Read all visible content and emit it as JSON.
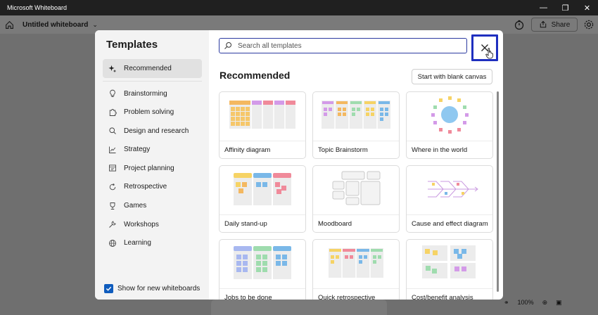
{
  "window": {
    "title": "Microsoft Whiteboard",
    "controls": [
      "minimize-icon",
      "restore-icon",
      "close-icon"
    ]
  },
  "appbar": {
    "board_title": "Untitled whiteboard",
    "share_label": "Share"
  },
  "zoom": {
    "value": "100%"
  },
  "modal": {
    "title": "Templates",
    "search_placeholder": "Search all templates",
    "section_title": "Recommended",
    "blank_button": "Start with blank canvas",
    "show_new_label": "Show for new whiteboards",
    "show_new_checked": true,
    "categories": [
      {
        "label": "Recommended",
        "icon": "sparkle-icon",
        "selected": true
      },
      {
        "label": "Brainstorming",
        "icon": "lightbulb-icon"
      },
      {
        "label": "Problem solving",
        "icon": "puzzle-icon"
      },
      {
        "label": "Design and research",
        "icon": "magnifier-icon"
      },
      {
        "label": "Strategy",
        "icon": "chart-line-icon"
      },
      {
        "label": "Project planning",
        "icon": "calendar-icon"
      },
      {
        "label": "Retrospective",
        "icon": "refresh-icon"
      },
      {
        "label": "Games",
        "icon": "trophy-icon"
      },
      {
        "label": "Workshops",
        "icon": "wrench-icon"
      },
      {
        "label": "Learning",
        "icon": "globe-icon"
      }
    ],
    "templates": [
      {
        "label": "Affinity diagram"
      },
      {
        "label": "Topic Brainstorm"
      },
      {
        "label": "Where in the world"
      },
      {
        "label": "Daily stand-up"
      },
      {
        "label": "Moodboard"
      },
      {
        "label": "Cause and effect diagram"
      },
      {
        "label": "Jobs to be done"
      },
      {
        "label": "Quick retrospective"
      },
      {
        "label": "Cost/benefit analysis"
      }
    ]
  },
  "colors": {
    "accent": "#0f5cbd",
    "highlight": "#1f2fbf",
    "yellow": "#f6d365",
    "orange": "#f4b860",
    "blue": "#7ab8e8",
    "green": "#9fdcae",
    "pink": "#f08a9a",
    "purple": "#d39ae8"
  }
}
